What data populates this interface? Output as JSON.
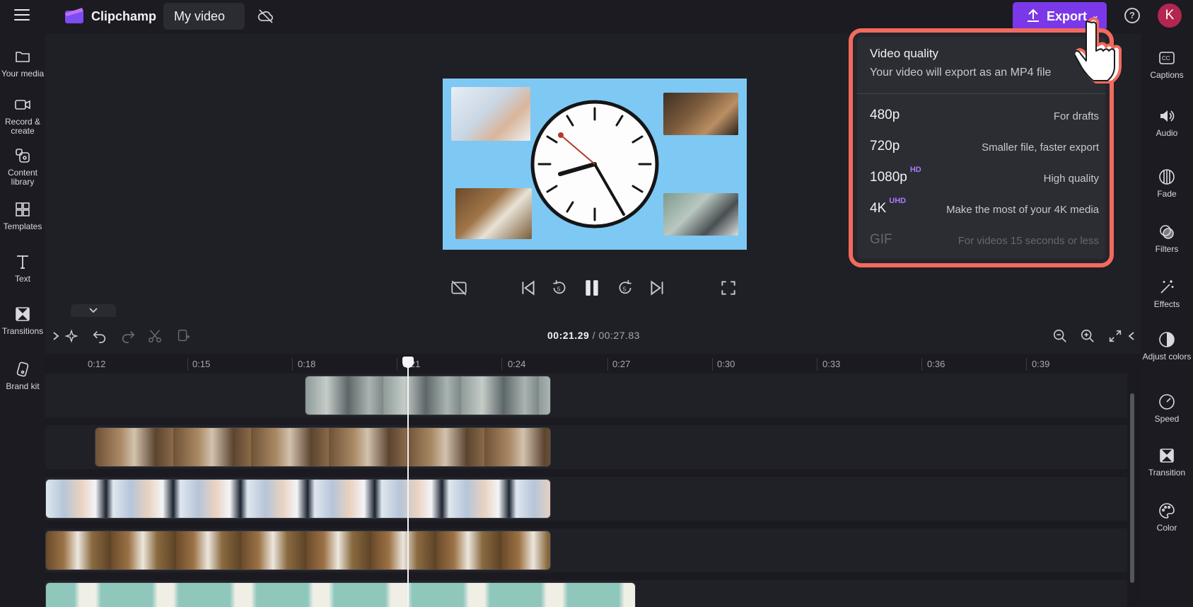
{
  "topbar": {
    "app_name": "Clipchamp",
    "video_title": "My video",
    "export_label": "Export",
    "avatar_initial": "K",
    "help_label": "?"
  },
  "left_sidebar": {
    "items": [
      {
        "label": "Your media",
        "icon": "folder-icon"
      },
      {
        "label": "Record & create",
        "icon": "camera-icon"
      },
      {
        "label": "Content library",
        "icon": "library-icon"
      },
      {
        "label": "Templates",
        "icon": "templates-icon"
      },
      {
        "label": "Text",
        "icon": "text-icon"
      },
      {
        "label": "Transitions",
        "icon": "transitions-icon"
      },
      {
        "label": "Brand kit",
        "icon": "brand-kit-icon"
      }
    ]
  },
  "right_sidebar": {
    "items": [
      {
        "label": "Captions",
        "icon": "captions-icon"
      },
      {
        "label": "Audio",
        "icon": "speaker-icon"
      },
      {
        "label": "Fade",
        "icon": "fade-icon"
      },
      {
        "label": "Filters",
        "icon": "filters-icon"
      },
      {
        "label": "Effects",
        "icon": "magic-wand-icon"
      },
      {
        "label": "Adjust colors",
        "icon": "adjust-colors-icon"
      },
      {
        "label": "Speed",
        "icon": "speedometer-icon"
      },
      {
        "label": "Transition",
        "icon": "transition-icon"
      },
      {
        "label": "Color",
        "icon": "palette-icon"
      }
    ]
  },
  "export_dropdown": {
    "title": "Video quality",
    "subtitle": "Your video will export as an MP4 file",
    "options": [
      {
        "resolution": "480p",
        "badge": "",
        "description": "For drafts",
        "enabled": true
      },
      {
        "resolution": "720p",
        "badge": "",
        "description": "Smaller file, faster export",
        "enabled": true
      },
      {
        "resolution": "1080p",
        "badge": "HD",
        "description": "High quality",
        "enabled": true
      },
      {
        "resolution": "4K",
        "badge": "UHD",
        "description": "Make the most of your 4K media",
        "enabled": true
      },
      {
        "resolution": "GIF",
        "badge": "",
        "description": "For videos 15 seconds or less",
        "enabled": false
      }
    ]
  },
  "timeline": {
    "current_time": "00:21.29",
    "separator": " / ",
    "total_time": "00:27.83",
    "ruler_labels": [
      "0:12",
      "0:15",
      "0:18",
      "0:21",
      "0:24",
      "0:27",
      "0:30",
      "0:33",
      "0:36",
      "0:39"
    ]
  },
  "colors": {
    "accent": "#7b38e8",
    "highlight_border": "#f26a5e",
    "canvas_background": "#7ec8f4",
    "badge": "#a67cff"
  }
}
